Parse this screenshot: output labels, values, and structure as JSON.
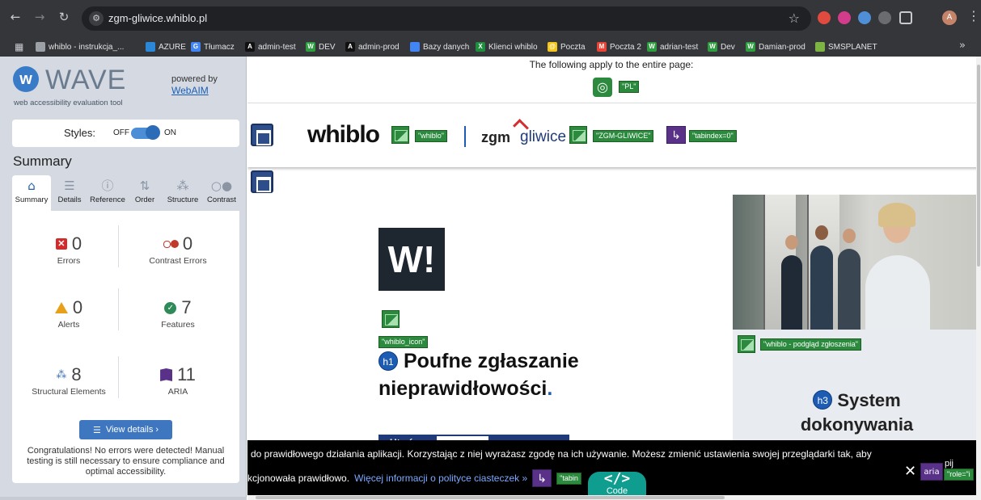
{
  "browser": {
    "url": "zgm-gliwice.whiblo.pl",
    "profile_initial": "A",
    "bookmarks": [
      {
        "label": "whiblo - instrukcja_...",
        "icon_color": "#9aa0a6",
        "icon_letter": ""
      },
      {
        "label": "AZURE",
        "icon_color": "#2b88d8",
        "icon_letter": ""
      },
      {
        "label": "Tłumacz",
        "icon_color": "#4285f4",
        "icon_letter": "G"
      },
      {
        "label": "admin-test",
        "icon_color": "#111111",
        "icon_letter": "A"
      },
      {
        "label": "DEV",
        "icon_color": "#2e9d3f",
        "icon_letter": "W"
      },
      {
        "label": "admin-prod",
        "icon_color": "#111111",
        "icon_letter": "A"
      },
      {
        "label": "Bazy danych",
        "icon_color": "#4285f4",
        "icon_letter": ""
      },
      {
        "label": "Klienci whiblo",
        "icon_color": "#1e8e3e",
        "icon_letter": "X"
      },
      {
        "label": "Poczta",
        "icon_color": "#f5c518",
        "icon_letter": "@"
      },
      {
        "label": "Poczta 2",
        "icon_color": "#ea4335",
        "icon_letter": "M"
      },
      {
        "label": "adrian-test",
        "icon_color": "#2e9d3f",
        "icon_letter": "W"
      },
      {
        "label": "Dev",
        "icon_color": "#2e9d3f",
        "icon_letter": "W"
      },
      {
        "label": "Damian-prod",
        "icon_color": "#2e9d3f",
        "icon_letter": "W"
      },
      {
        "label": "SMSPLANET",
        "icon_color": "#7cb342",
        "icon_letter": ""
      }
    ]
  },
  "wave": {
    "title": "WAVE",
    "subtitle": "web accessibility evaluation tool",
    "powered_by": "powered by",
    "webaim": "WebAIM",
    "styles_label": "Styles:",
    "styles_off": "OFF",
    "styles_on": "ON",
    "summary_heading": "Summary",
    "tabs": [
      "Summary",
      "Details",
      "Reference",
      "Order",
      "Structure",
      "Contrast"
    ],
    "stats": {
      "errors": {
        "count": "0",
        "label": "Errors"
      },
      "contrast": {
        "count": "0",
        "label": "Contrast Errors"
      },
      "alerts": {
        "count": "0",
        "label": "Alerts"
      },
      "features": {
        "count": "7",
        "label": "Features"
      },
      "structural": {
        "count": "8",
        "label": "Structural Elements"
      },
      "aria": {
        "count": "11",
        "label": "ARIA"
      }
    },
    "view_details": "View details ›",
    "congrats": "Congratulations! No errors were detected! Manual testing is still necessary to ensure compliance and optimal accessibility."
  },
  "page": {
    "apply_text": "The following apply to the entire page:",
    "lang_tag": "\"PL\"",
    "logo": "whiblo",
    "whiblo_tag": "\"whiblo\"",
    "zgm": "zgm",
    "gliwice": "gliwice",
    "zgm_tag": "\"ZGM-GLIWICE\"",
    "tabindex_tag": "\"tabindex=0\"",
    "hero_mark": "W!",
    "whiblo_icon_tag": "\"whiblo_icon\"",
    "h1_badge": "h1",
    "h1_line1": "Poufne zgłaszanie",
    "h1_line2": "nieprawidłowości",
    "h1_dot": ".",
    "btn_utworz": "Utwórz",
    "preview_tag": "\"whiblo - podgląd zgłoszenia\"",
    "h3_badge": "h3",
    "h3_line1": "System",
    "h3_line2": "dokonywania",
    "cookie_line1": "do prawidłowego działania aplikacji. Korzystając z niej wyrażasz zgodę na ich używanie. Możesz zmienić ustawienia swojej przeglądarki tak, aby",
    "cookie_line2_prefix": "kcjonowała prawidłowo.",
    "cookie_link": "Więcej informacji o polityce ciasteczek »",
    "cookie_tabindex_tag": "\"tabin",
    "cookie_extra": "pij",
    "cookie_role_tag": "\"role=\"i",
    "aria_label": "aria",
    "code_symbol": "</>",
    "code_label": "Code"
  },
  "colors": {
    "wave_green": "#2b8a3e",
    "wave_purple": "#5a3188",
    "wave_blue": "#1e5cb3",
    "brand_navy": "#1e3a7b"
  }
}
